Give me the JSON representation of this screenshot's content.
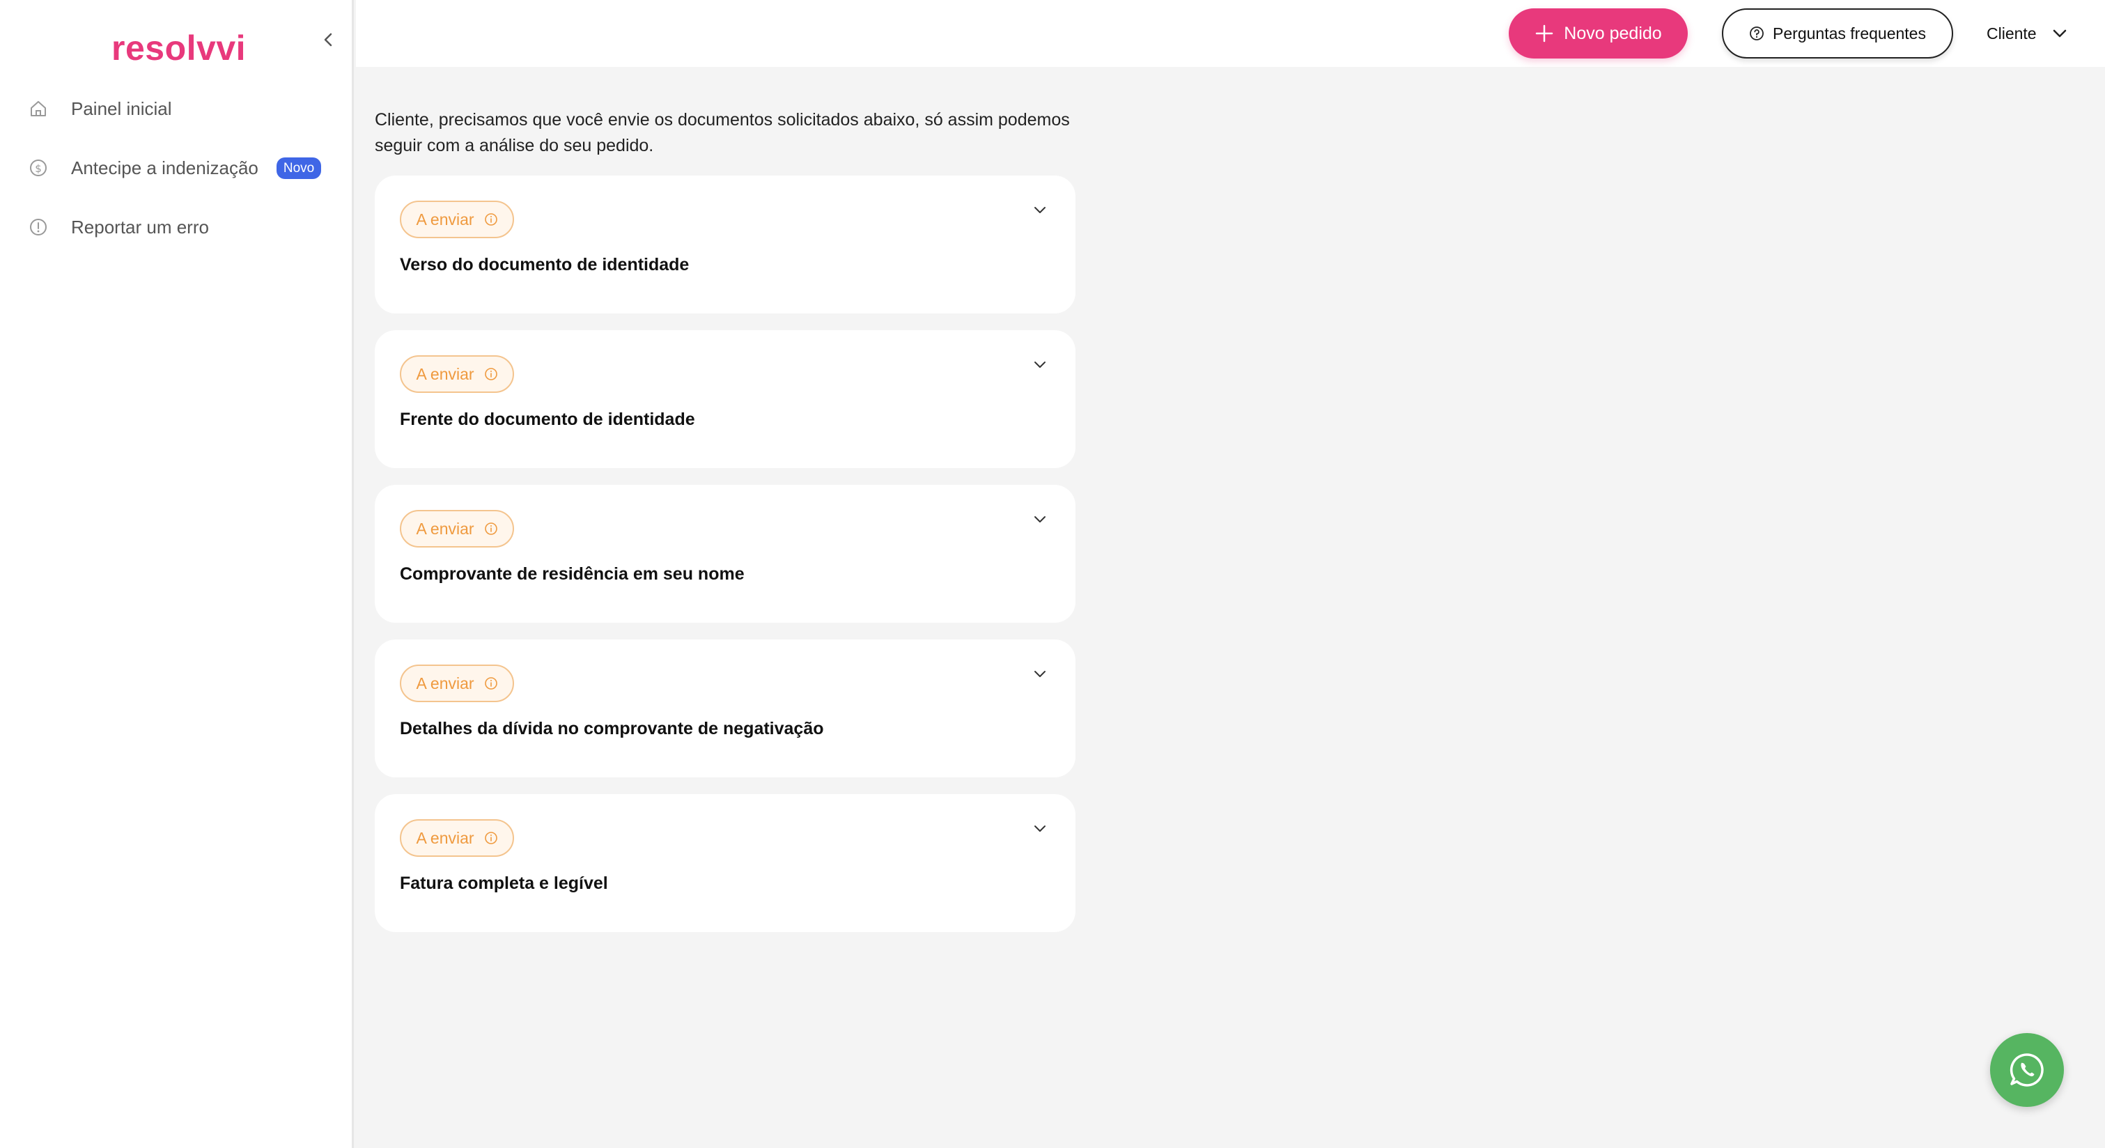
{
  "brand": {
    "logo_text": "resolvvi",
    "color": "#e8397c"
  },
  "sidebar": {
    "items": [
      {
        "label": "Painel inicial",
        "icon": "home-icon"
      },
      {
        "label": "Antecipe a indenização",
        "icon": "dollar-icon",
        "badge": "Novo"
      },
      {
        "label": "Reportar um erro",
        "icon": "alert-icon"
      }
    ]
  },
  "topbar": {
    "new_order_label": "Novo pedido",
    "faq_label": "Perguntas frequentes",
    "user_label": "Cliente"
  },
  "main": {
    "intro": "Cliente, precisamos que você envie os documentos solicitados abaixo, só assim podemos seguir com a análise do seu pedido.",
    "documents": [
      {
        "status": "A enviar",
        "title": "Verso do documento de identidade"
      },
      {
        "status": "A enviar",
        "title": "Frente do documento de identidade"
      },
      {
        "status": "A enviar",
        "title": "Comprovante de residência em seu nome"
      },
      {
        "status": "A enviar",
        "title": "Detalhes da dívida no comprovante de negativação"
      },
      {
        "status": "A enviar",
        "title": "Fatura completa e legível"
      }
    ]
  },
  "colors": {
    "accent": "#e8397c",
    "status_pending": "#ef9a3f",
    "badge_blue": "#3f66e6",
    "whatsapp_green": "#56b561"
  }
}
